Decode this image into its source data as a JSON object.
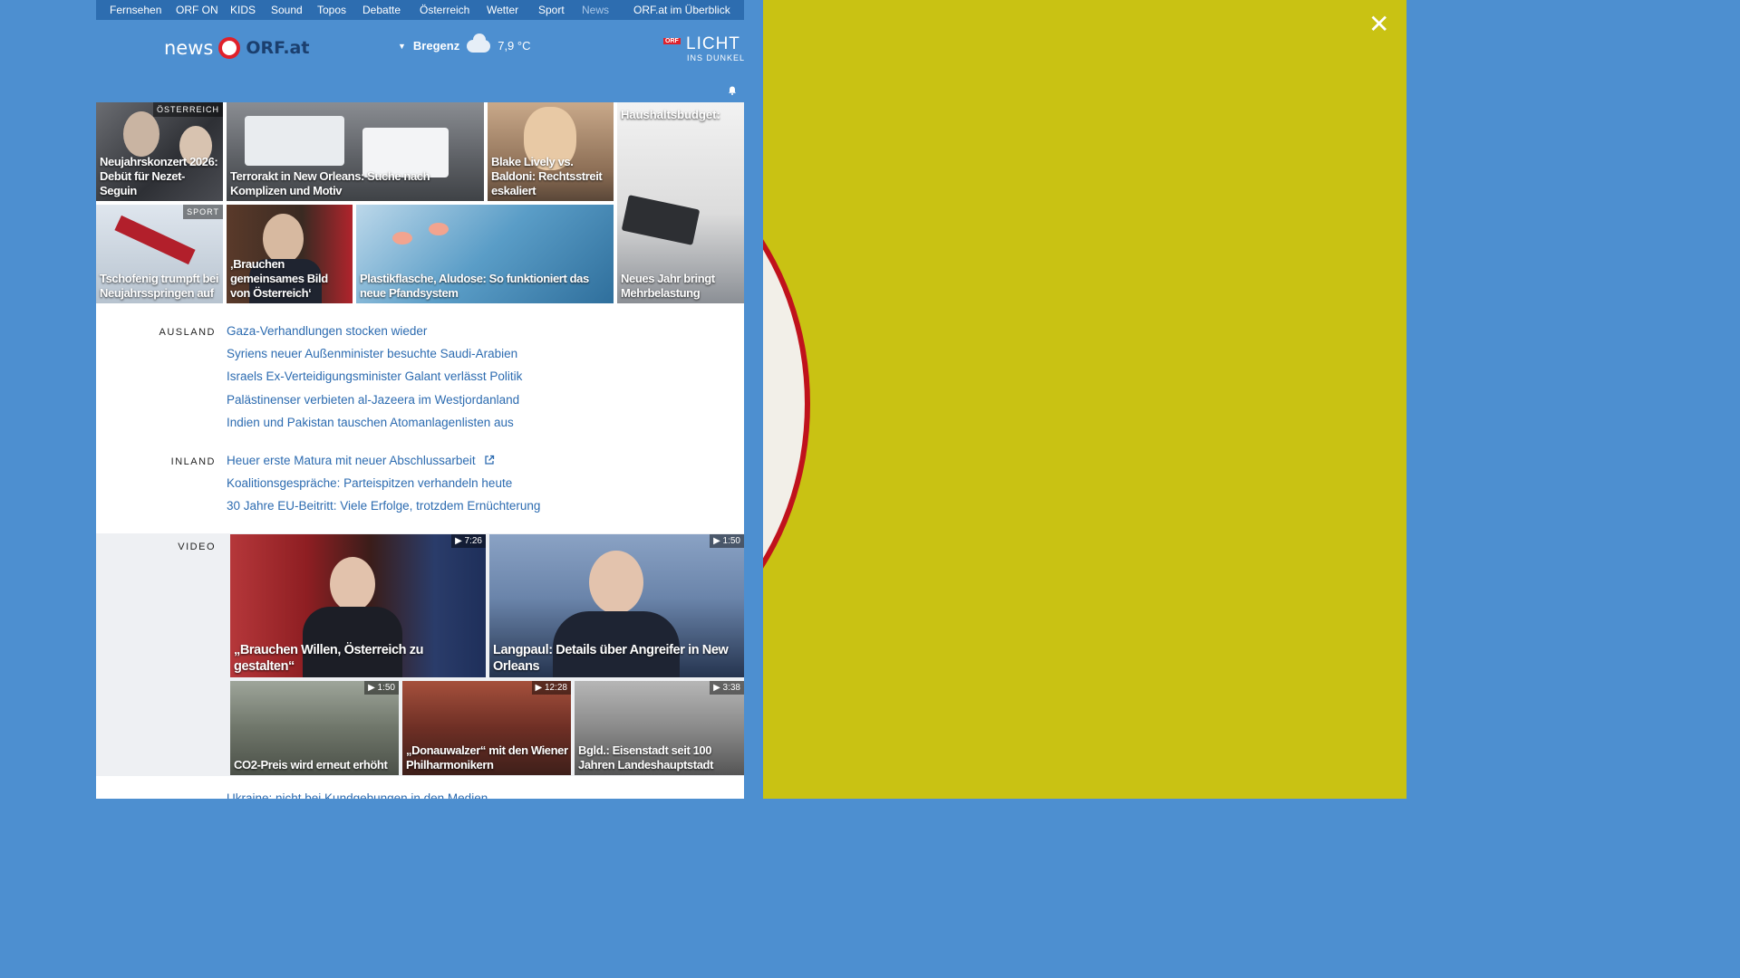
{
  "topnav": {
    "items": [
      "Fernsehen",
      "ORF ON",
      "KIDS",
      "Sound",
      "Topos",
      "Debatte",
      "Österreich",
      "Wetter",
      "Sport",
      "News",
      "ORF.at im Überblick"
    ]
  },
  "header": {
    "logo_word": "news",
    "logo_site": "ORF.at",
    "location": "Bregenz",
    "temperature": "7,9 °C",
    "campaign_badge": "ORF",
    "campaign_title": "LICHT",
    "campaign_sub": "INS DUNKEL"
  },
  "tiles_row1": [
    {
      "tag": "ÖSTERREICH",
      "caption": "Neujahrskonzert 2026: Debüt für Nezet-Seguin"
    },
    {
      "caption": "Terrorakt in New Orleans: Suche nach Komplizen und Motiv"
    },
    {
      "caption": "Blake Lively vs. Baldoni: Rechtsstreit eskaliert"
    },
    {
      "top_caption": "Haushaltsbudget:",
      "caption": "Neues Jahr bringt Mehrbelastung"
    }
  ],
  "tiles_row2": [
    {
      "tag": "SPORT",
      "caption": "Tschofenig trumpft bei Neujahrsspringen auf"
    },
    {
      "caption": "‚Brauchen gemeinsames Bild von Österreich‘"
    },
    {
      "caption": "Plastikflasche, Aludose: So funktioniert das neue Pfandsystem"
    }
  ],
  "sections": {
    "ausland": {
      "label": "AUSLAND",
      "links": [
        "Gaza-Verhandlungen stocken wieder",
        "Syriens neuer Außenminister besuchte Saudi-Arabien",
        "Israels Ex-Verteidigungsminister Galant verlässt Politik",
        "Palästinenser verbieten al-Jazeera im Westjordanland",
        "Indien und Pakistan tauschen Atomanlagenlisten aus"
      ]
    },
    "inland": {
      "label": "INLAND",
      "links": [
        "Heuer erste Matura mit neuer Abschlussarbeit",
        "Koalitionsgespräche: Parteispitzen verhandeln heute",
        "30 Jahre EU-Beitritt: Viele Erfolge, trotzdem Ernüchterung"
      ]
    },
    "video": {
      "label": "VIDEO",
      "large": [
        {
          "duration": "7:26",
          "caption": "„Brauchen Willen, Österreich zu gestalten“"
        },
        {
          "duration": "1:50",
          "caption": "Langpaul: Details über Angreifer in New Orleans"
        }
      ],
      "small": [
        {
          "duration": "1:50",
          "caption": "CO2-Preis wird erneut erhöht"
        },
        {
          "duration": "12:28",
          "caption": "„Donauwalzer“ mit den Wiener Philharmonikern"
        },
        {
          "duration": "3:38",
          "caption": "Bgld.: Eisenstadt seit 100 Jahren Landeshauptstadt"
        }
      ]
    },
    "cutoff_link": "Ukraine: nicht bei Kundgebungen in den Medien"
  },
  "ad": {
    "close_label": "✕"
  },
  "colors": {
    "brand_blue": "#4d8fd0",
    "nav_blue": "#2d6db0",
    "link": "#2c6bb0",
    "orf_red": "#e0212b",
    "ad_yellow": "#c9c213"
  }
}
